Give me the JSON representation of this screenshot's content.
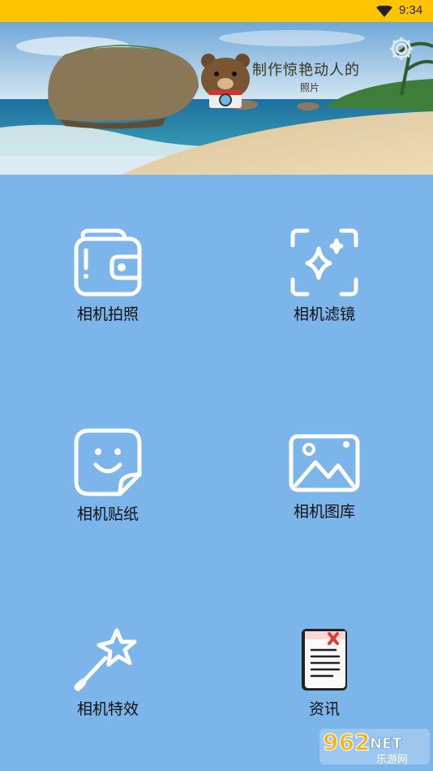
{
  "status_bar": {
    "time": "9:34"
  },
  "banner": {
    "title_line1": "制作惊艳动人的",
    "title_line2": "照片",
    "settings_icon": "gear-icon"
  },
  "grid": [
    {
      "label": "相机拍照",
      "icon": "wallet-icon"
    },
    {
      "label": "相机滤镜",
      "icon": "sparkle-frame-icon"
    },
    {
      "label": "相机贴纸",
      "icon": "sticker-icon"
    },
    {
      "label": "相机图库",
      "icon": "gallery-icon"
    },
    {
      "label": "相机特效",
      "icon": "magic-wand-icon"
    },
    {
      "label": "资讯",
      "icon": "book-icon"
    }
  ],
  "watermark": {
    "brand": "962",
    "suffix": "NET",
    "sub": "乐游网"
  },
  "colors": {
    "status_bar": "#ffc400",
    "background": "#7cb5ea",
    "icon_stroke": "#ffffff"
  }
}
